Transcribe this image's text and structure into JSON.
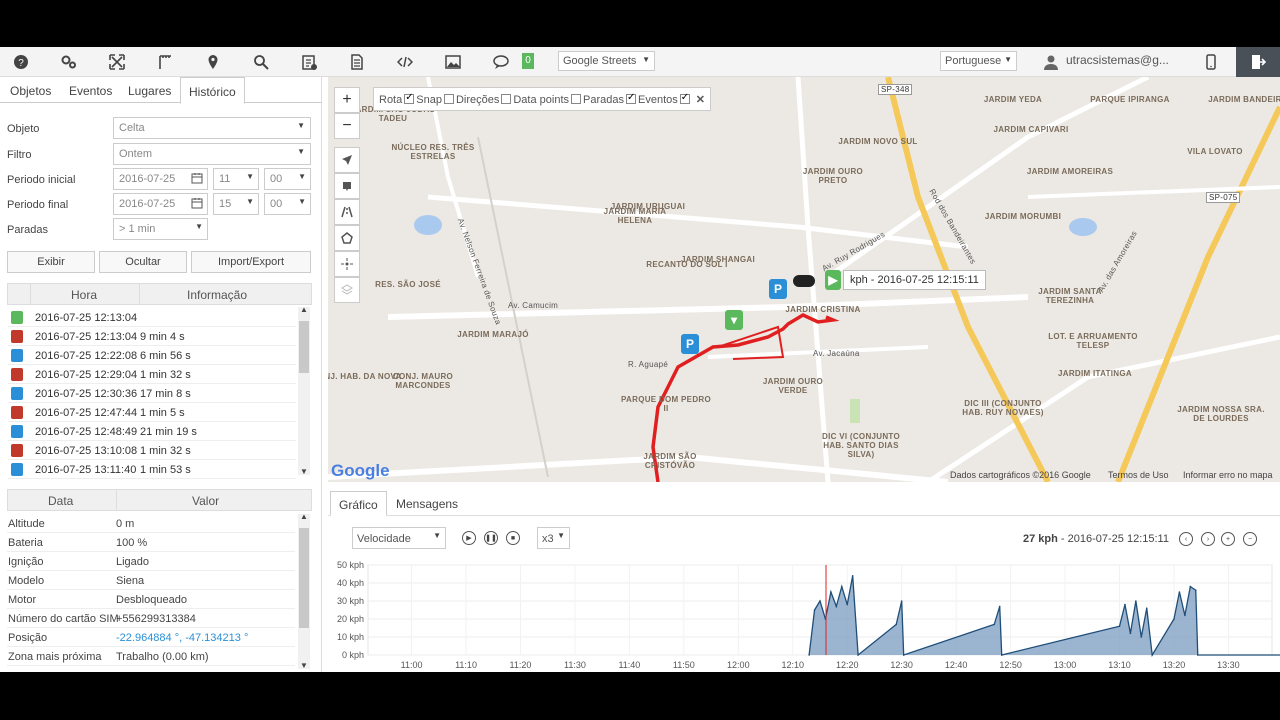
{
  "topbar": {
    "icons": [
      "help-icon",
      "settings-icon",
      "fullscreen-icon",
      "ruler-icon",
      "map-marker-icon",
      "search-icon",
      "clipboard-icon",
      "document-icon",
      "code-icon",
      "image-icon",
      "chat-icon"
    ],
    "chat_count": "0",
    "map_type": "Google Streets",
    "language": "Portuguese",
    "user": "utracsistemas@g..."
  },
  "left": {
    "tabs": [
      "Objetos",
      "Eventos",
      "Lugares",
      "Histórico"
    ],
    "form": {
      "objeto_label": "Objeto",
      "objeto_value": "Celta",
      "filtro_label": "Filtro",
      "filtro_value": "Ontem",
      "inicio_label": "Periodo inicial",
      "inicio_date": "2016-07-25",
      "inicio_hour": "11",
      "inicio_min": "00",
      "final_label": "Periodo final",
      "final_date": "2016-07-25",
      "final_hour": "15",
      "final_min": "00",
      "paradas_label": "Paradas",
      "paradas_value": "> 1 min"
    },
    "buttons": {
      "show": "Exibir",
      "hide": "Ocultar",
      "import": "Import/Export"
    },
    "history_headers": {
      "hora": "Hora",
      "info": "Informação"
    },
    "history": [
      {
        "time": "2016-07-25 12:13:04",
        "dur": "",
        "type": "start",
        "color": "#5cb85c"
      },
      {
        "time": "2016-07-25 12:13:04",
        "dur": "9 min 4 s",
        "type": "drive",
        "color": "#c0392b"
      },
      {
        "time": "2016-07-25 12:22:08",
        "dur": "6 min 56 s",
        "type": "park",
        "color": "#2a8fd6"
      },
      {
        "time": "2016-07-25 12:29:04",
        "dur": "1 min 32 s",
        "type": "drive",
        "color": "#c0392b"
      },
      {
        "time": "2016-07-25 12:30:36",
        "dur": "17 min 8 s",
        "type": "park",
        "color": "#2a8fd6"
      },
      {
        "time": "2016-07-25 12:47:44",
        "dur": "1 min 5 s",
        "type": "drive",
        "color": "#c0392b"
      },
      {
        "time": "2016-07-25 12:48:49",
        "dur": "21 min 19 s",
        "type": "park",
        "color": "#2a8fd6"
      },
      {
        "time": "2016-07-25 13:10:08",
        "dur": "1 min 32 s",
        "type": "drive",
        "color": "#c0392b"
      },
      {
        "time": "2016-07-25 13:11:40",
        "dur": "1 min 53 s",
        "type": "park",
        "color": "#2a8fd6"
      }
    ],
    "data_headers": {
      "data": "Data",
      "valor": "Valor"
    },
    "data_rows": [
      {
        "k": "Altitude",
        "v": "0 m"
      },
      {
        "k": "Bateria",
        "v": "100 %"
      },
      {
        "k": "Ignição",
        "v": "Ligado"
      },
      {
        "k": "Modelo",
        "v": "Siena"
      },
      {
        "k": "Motor",
        "v": "Desbloqueado"
      },
      {
        "k": "Número do cartão SIM",
        "v": "+556299313384"
      },
      {
        "k": "Posição",
        "v": "-22.964884 °, -47.134213 °",
        "link": true
      },
      {
        "k": "Zona mais próxima",
        "v": "Trabalho (0.00 km)"
      }
    ]
  },
  "map": {
    "zoom_in": "+",
    "zoom_out": "−",
    "layers": [
      {
        "label": "Rota",
        "on": true
      },
      {
        "label": "Snap",
        "on": false
      },
      {
        "label": "Direções",
        "on": false
      },
      {
        "label": "Data points",
        "on": false
      },
      {
        "label": "Paradas",
        "on": true
      },
      {
        "label": "Eventos",
        "on": true
      }
    ],
    "close": "✕",
    "tooltip": "kph - 2016-07-25 12:15:11",
    "google": "Google",
    "attribution": [
      "Dados cartográficos ©2016 Google",
      "Termos de Uso",
      "Informar erro no mapa"
    ],
    "labels": [
      "JARDIM YEDA",
      "PARQUE IPIRANGA",
      "JARDIM CAPIVARI",
      "VILA LOVATO",
      "JARDIM BANDEIRA",
      "JARDIM SÃO JUDAS TADEU",
      "JARDIM NOVO SUL",
      "JARDIM OURO PRETO",
      "JARDIM AMOREIRAS",
      "NÚCLEO RES. TRÊS ESTRELAS",
      "JARDIM URUGUAI",
      "JARDIM MARIA HELENA",
      "JARDIM MORUMBI",
      "RECANTO DO SOL I",
      "JARDIM SHANGAI",
      "JARDIM CRISTINA",
      "RES. SÃO JOSÉ",
      "JARDIM SANTA TEREZINHA",
      "JARDIM MARAJÓ",
      "LOT. E ARRUAMENTO TELESP",
      "JARDIM ITATINGA",
      "CONJ. MAURO MARCONDES",
      "JARDIM OURO VERDE",
      "PARQUE DOM PEDRO II",
      "DIC III (CONJUNTO HAB. RUY NOVAES)",
      "JARDIM NOSSA SRA. DE LOURDES",
      "DIC VI (CONJUNTO HAB. SANTO DIAS SILVA)",
      "JARDIM SÃO CRISTÓVÃO",
      "NJ. HAB. DA NOVA"
    ],
    "roads": [
      "Av. Camucim",
      "SP-348",
      "SP-075",
      "Rod dos Bandeirantes",
      "Av. Ruy Rodrigues",
      "Av. Jacaúna",
      "R. Aguapé",
      "Av. Nelson Ferreira de Souza",
      "Av. das Amoreiras"
    ]
  },
  "chart": {
    "tabs": [
      "Gráfico",
      "Mensagens"
    ],
    "sensor": "Velocidade",
    "speed_mult": "x3",
    "readout_value": "27 kph",
    "readout_time": " - 2016-07-25 12:15:11"
  },
  "chart_data": {
    "type": "area",
    "title": "",
    "ylabel": "kph",
    "ylim": [
      0,
      50
    ],
    "yticks": [
      "0 kph",
      "10 kph",
      "20 kph",
      "30 kph",
      "40 kph",
      "50 kph"
    ],
    "xticks": [
      "11:00",
      "11:10",
      "11:20",
      "11:30",
      "11:40",
      "11:50",
      "12:00",
      "12:10",
      "12:20",
      "12:30",
      "12:40",
      "12:50",
      "13:00",
      "13:10",
      "13:20",
      "13:30"
    ],
    "x": [
      "12:13",
      "12:14",
      "12:15",
      "12:16",
      "12:17",
      "12:18",
      "12:19",
      "12:20",
      "12:21",
      "12:22",
      "12:29",
      "12:30",
      "12:30",
      "12:47",
      "12:48",
      "12:48",
      "13:10",
      "13:11",
      "13:12",
      "13:13",
      "13:14",
      "13:15",
      "13:16",
      "13:20",
      "13:21",
      "13:22",
      "13:23",
      "13:24",
      "13:24",
      "13:42"
    ],
    "values": [
      0,
      25,
      30,
      20,
      35,
      27,
      38,
      28,
      44,
      0,
      17,
      30,
      0,
      17,
      27,
      0,
      16,
      28,
      12,
      30,
      10,
      26,
      0,
      20,
      35,
      22,
      38,
      36,
      0,
      0
    ],
    "color": "#1f4e79",
    "fill": "#7a9cc0"
  },
  "colors": {
    "accent": "#2a8fd6",
    "route": "#e02020",
    "green": "#5cb85c"
  }
}
